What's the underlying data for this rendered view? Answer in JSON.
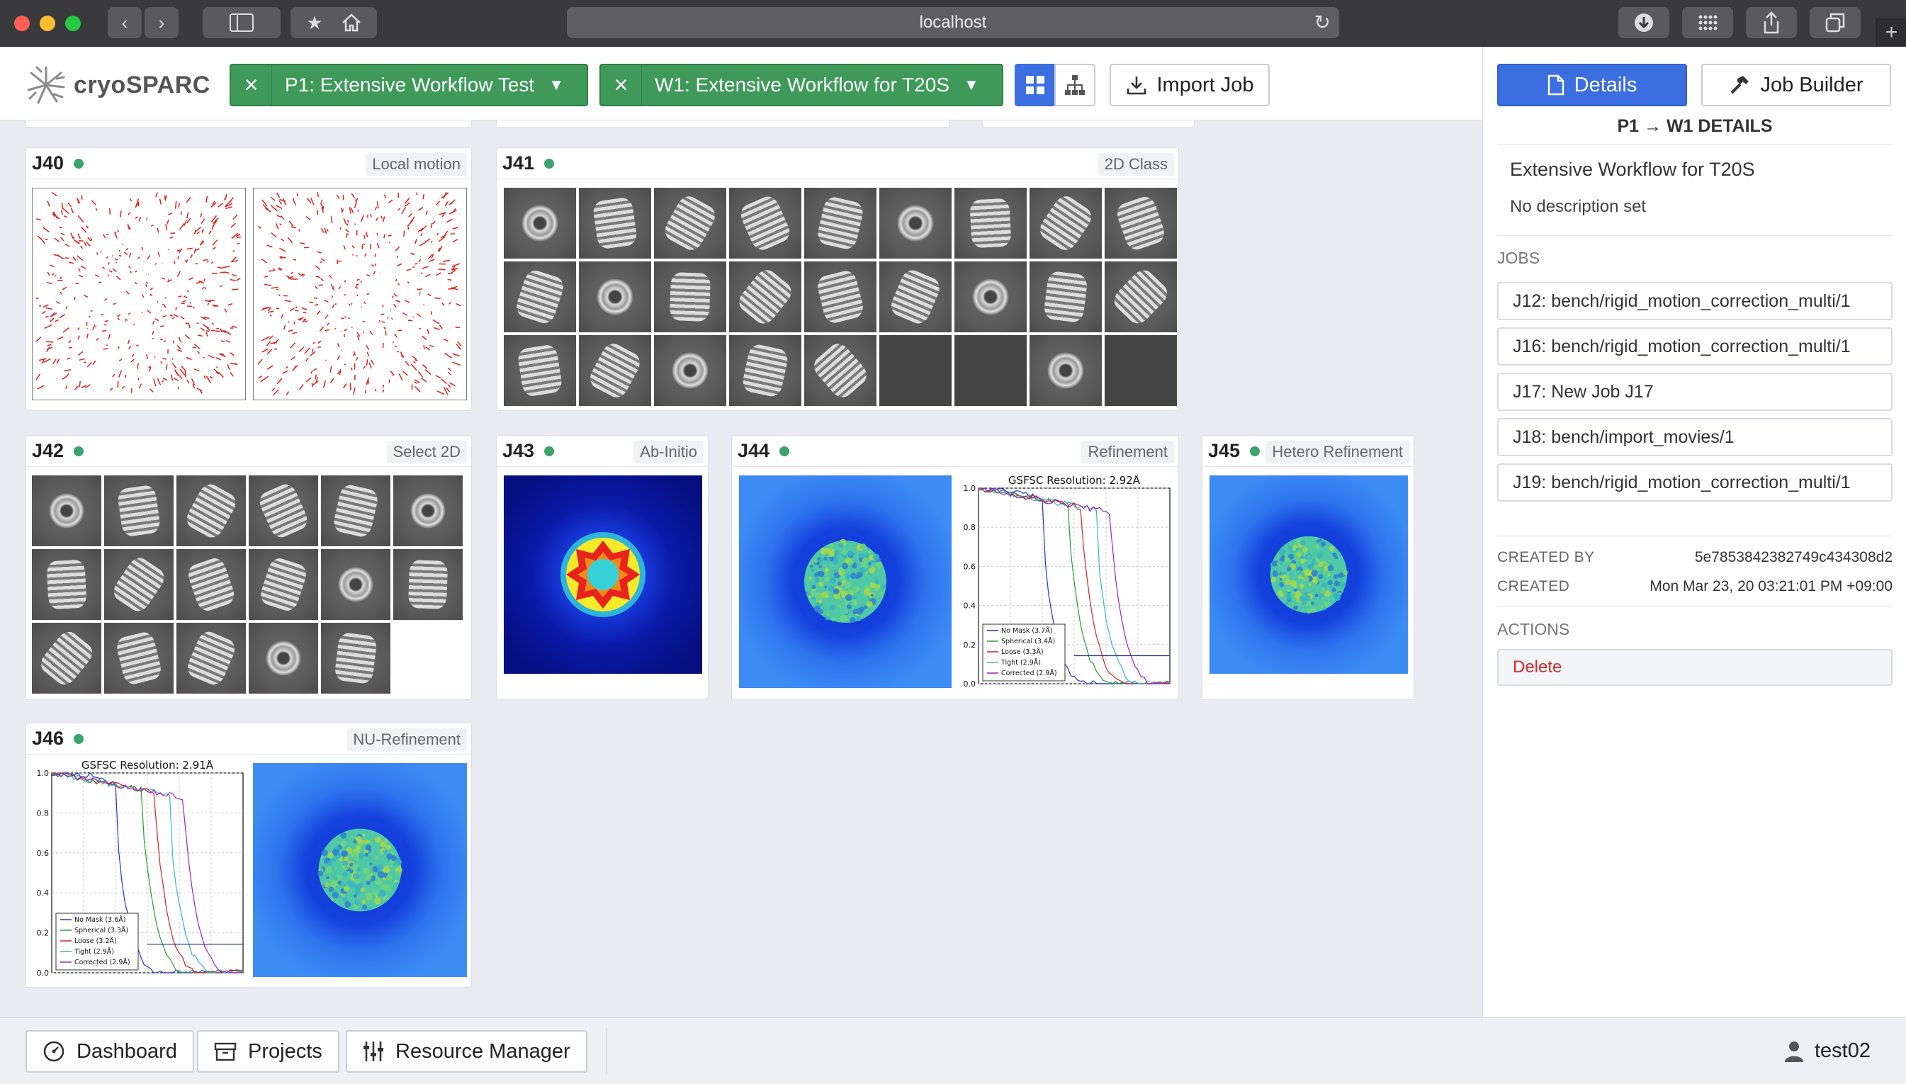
{
  "browser": {
    "url": "localhost"
  },
  "header": {
    "logo_text": "cryoSPARC",
    "project_tab": "P1: Extensive Workflow Test",
    "workflow_tab": "W1: Extensive Workflow for T20S",
    "import_label": "Import Job"
  },
  "cards": [
    {
      "id": "J40",
      "type": "Local motion"
    },
    {
      "id": "J41",
      "type": "2D Class"
    },
    {
      "id": "J42",
      "type": "Select 2D"
    },
    {
      "id": "J43",
      "type": "Ab-Initio"
    },
    {
      "id": "J44",
      "type": "Refinement"
    },
    {
      "id": "J45",
      "type": "Hetero Refinement"
    },
    {
      "id": "J46",
      "type": "NU-Refinement"
    }
  ],
  "fsc_j44": {
    "title": "GSFSC Resolution: 2.92Å",
    "yticks": [
      "1.0",
      "0.8",
      "0.6",
      "0.4",
      "0.2",
      "0.0"
    ],
    "legend": [
      "No Mask (3.7Å)",
      "Spherical (3.4Å)",
      "Loose (3.3Å)",
      "Tight (2.9Å)",
      "Corrected (2.9Å)"
    ]
  },
  "fsc_j46": {
    "title": "GSFSC Resolution: 2.91Å",
    "yticks": [
      "1.0",
      "0.8",
      "0.6",
      "0.4",
      "0.2",
      "0.0"
    ],
    "legend": [
      "No Mask (3.6Å)",
      "Spherical (3.3Å)",
      "Loose (3.2Å)",
      "Tight (2.9Å)",
      "Corrected (2.9Å)"
    ]
  },
  "colors": {
    "accent": "#3b6fe0",
    "workflow_green": "#3f9a5a",
    "status_green": "#3aa46a",
    "delete_red": "#d12a2a"
  },
  "details": {
    "tab_details": "Details",
    "tab_builder": "Job Builder",
    "heading": "P1 → W1 DETAILS",
    "name": "Extensive Workflow for T20S",
    "description": "No description set",
    "jobs_label": "JOBS",
    "jobs": [
      "J12: bench/rigid_motion_correction_multi/1",
      "J16: bench/rigid_motion_correction_multi/1",
      "J17: New Job J17",
      "J18: bench/import_movies/1",
      "J19: bench/rigid_motion_correction_multi/1"
    ],
    "created_by_label": "CREATED BY",
    "created_by": "5e7853842382749c434308d2",
    "created_label": "CREATED",
    "created": "Mon Mar 23, 20 03:21:01 PM +09:00",
    "actions_label": "ACTIONS",
    "delete_label": "Delete"
  },
  "bottom": {
    "dashboard": "Dashboard",
    "projects": "Projects",
    "resource_manager": "Resource Manager",
    "user": "test02"
  }
}
